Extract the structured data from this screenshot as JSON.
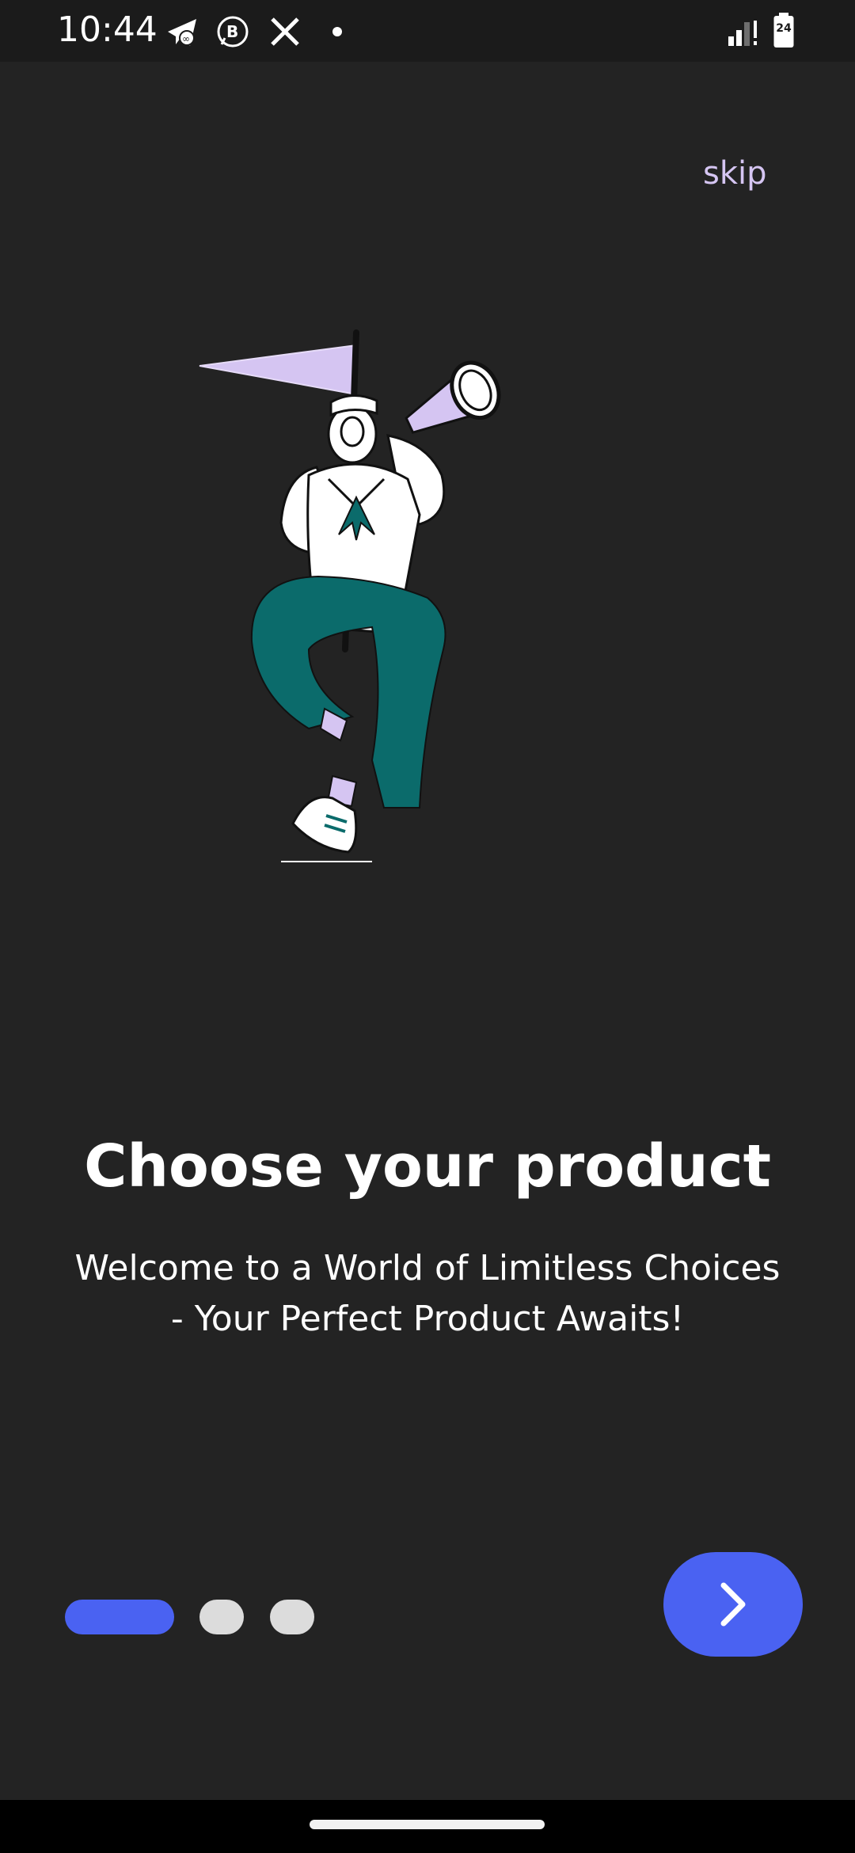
{
  "status_bar": {
    "time": "10:44",
    "battery_level": "24",
    "notification_icons": [
      "telegram-icon",
      "whatsapp-business-icon",
      "x-icon",
      "dot-icon"
    ],
    "right_icons": [
      "signal-icon",
      "battery-icon"
    ]
  },
  "onboarding": {
    "skip_label": "skip",
    "title": "Choose your product",
    "subtitle_line1": "Welcome to a World of Limitless Choices",
    "subtitle_line2": "- Your Perfect Product Awaits!",
    "page_indicator": {
      "total": 3,
      "current": 1
    },
    "next_icon": "chevron-right-icon"
  },
  "colors": {
    "background": "#232323",
    "accent": "#4a62f2",
    "skip_text": "#d5c5f2",
    "illustration_teal": "#0b6b6b",
    "illustration_lavender": "#d5c5f2",
    "inactive_dot": "#dcdcdc"
  }
}
